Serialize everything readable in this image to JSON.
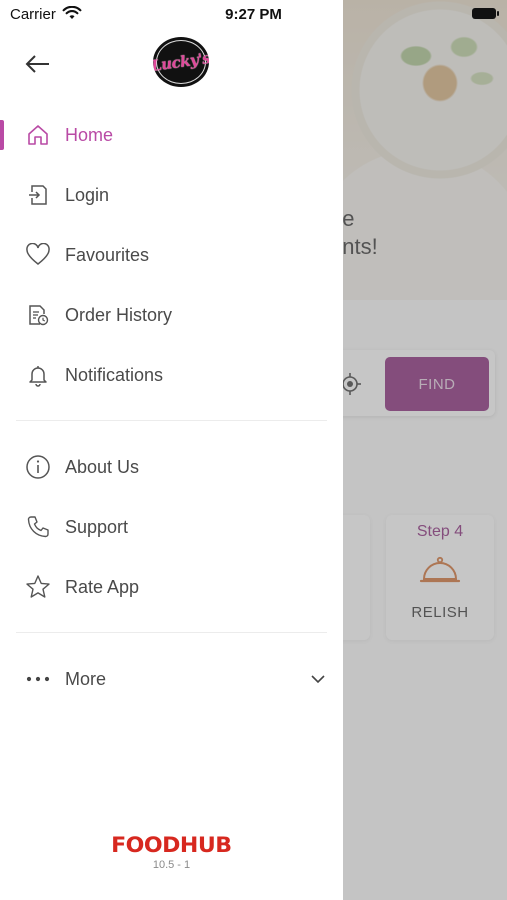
{
  "status_bar": {
    "carrier": "Carrier",
    "time": "9:27 PM",
    "wifi_icon": "wifi-icon",
    "battery_icon": "battery-icon"
  },
  "drawer": {
    "logo_text": "Lucky's",
    "back_icon": "arrow-left-icon",
    "active_color": "#b94aa5",
    "items": [
      {
        "label": "Home",
        "icon": "home-icon",
        "active": true
      },
      {
        "label": "Login",
        "icon": "login-icon"
      },
      {
        "label": "Favourites",
        "icon": "heart-icon"
      },
      {
        "label": "Order History",
        "icon": "order-history-icon"
      },
      {
        "label": "Notifications",
        "icon": "bell-icon"
      },
      {
        "label": "About Us",
        "icon": "info-icon"
      },
      {
        "label": "Support",
        "icon": "phone-icon"
      },
      {
        "label": "Rate App",
        "icon": "star-icon"
      },
      {
        "label": "More",
        "icon": "more-dots-icon",
        "expand_icon": "chevron-down-icon"
      }
    ],
    "brand": "FOODHUB",
    "brand_color": "#d7281f",
    "version": "10.5 - 1"
  },
  "background": {
    "headline": "ne\nunts!",
    "find_label": "FIND",
    "find_color": "#8d2f80",
    "step_label": "Step 4",
    "step_caption": "RELISH"
  }
}
